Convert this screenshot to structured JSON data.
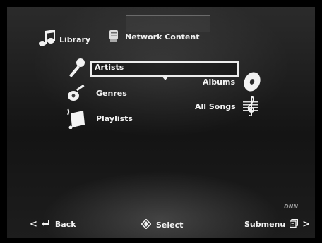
{
  "tabs": {
    "library": "Library",
    "network": "Network Content"
  },
  "menu": {
    "items": [
      {
        "label": "Artists",
        "icon": "microphone-icon",
        "selected": true
      },
      {
        "label": "Genres",
        "icon": "guitar-icon"
      },
      {
        "label": "Playlists",
        "icon": "playlist-icon"
      }
    ],
    "right_items": [
      {
        "label": "Albums",
        "icon": "disc-icon"
      },
      {
        "label": "All Songs",
        "icon": "treble-clef-icon"
      }
    ]
  },
  "footer": {
    "back": "Back",
    "select": "Select",
    "submenu": "Submenu"
  },
  "logo": "DNN"
}
